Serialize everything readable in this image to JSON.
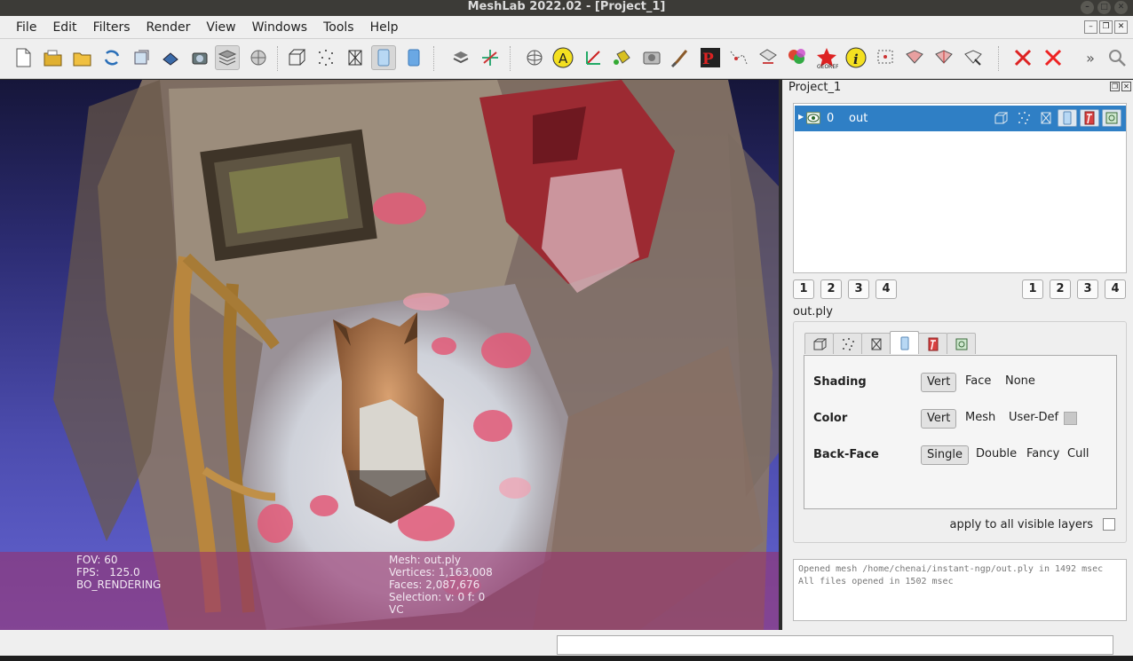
{
  "window": {
    "title": "MeshLab 2022.02 - [Project_1]"
  },
  "menubar": {
    "items": [
      "File",
      "Edit",
      "Filters",
      "Render",
      "View",
      "Windows",
      "Tools",
      "Help"
    ]
  },
  "toolbar": {
    "overflow_label": "»"
  },
  "viewport": {
    "info_left": [
      "FOV: 60",
      "FPS:   125.0",
      "BO_RENDERING"
    ],
    "info_right": [
      "Mesh: out.ply",
      "Vertices: 1,163,008",
      "Faces: 2,087,676",
      "Selection: v: 0 f: 0",
      "VC"
    ]
  },
  "panel": {
    "title": "Project_1",
    "layer": {
      "index": "0",
      "name": "out"
    },
    "view_buttons_left": [
      "1",
      "2",
      "3",
      "4"
    ],
    "view_buttons_right": [
      "1",
      "2",
      "3",
      "4"
    ],
    "mesh_name": "out.ply",
    "render": {
      "shading_label": "Shading",
      "shading_options": [
        "Vert",
        "Face",
        "None"
      ],
      "color_label": "Color",
      "color_options": [
        "Vert",
        "Mesh",
        "User-Def"
      ],
      "backface_label": "Back-Face",
      "backface_options": [
        "Single",
        "Double",
        "Fancy",
        "Cull"
      ],
      "apply_all_label": "apply to all visible layers"
    },
    "log": [
      "Opened mesh /home/chenai/instant-ngp/out.ply in 1492 msec",
      "All files opened in 1502 msec"
    ]
  },
  "colors": {
    "selection": "#2f7fc5",
    "overlay": "#963270"
  }
}
